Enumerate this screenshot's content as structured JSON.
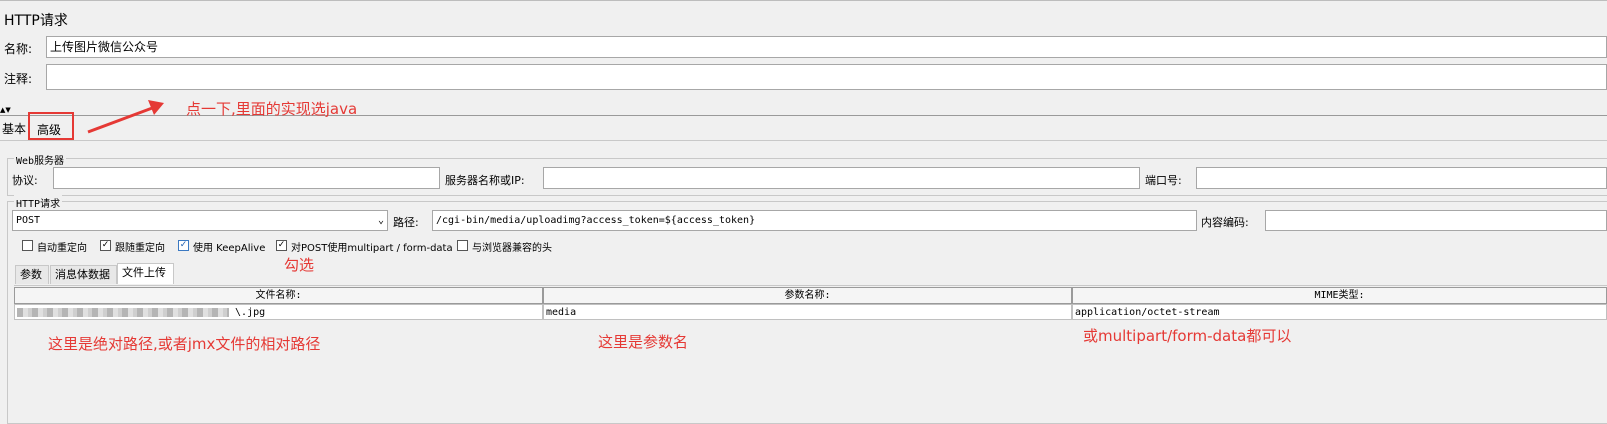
{
  "panel": {
    "title": "HTTP请求"
  },
  "form": {
    "name_label": "名称:",
    "name_value": "上传图片微信公众号",
    "comment_label": "注释:",
    "comment_value": ""
  },
  "tabs": {
    "basic": "基本",
    "advanced": "高级"
  },
  "web_server": {
    "title": "Web服务器",
    "protocol_label": "协议:",
    "protocol_value": "",
    "server_label": "服务器名称或IP:",
    "server_value": "",
    "port_label": "端口号:",
    "port_value": ""
  },
  "http_request": {
    "title": "HTTP请求",
    "method": "POST",
    "path_label": "路径:",
    "path_value": "/cgi-bin/media/uploadimg?access_token=${access_token}",
    "encoding_label": "内容编码:",
    "encoding_value": ""
  },
  "options": [
    {
      "label": "自动重定向",
      "checked": false
    },
    {
      "label": "跟随重定向",
      "checked": true
    },
    {
      "label": "使用 KeepAlive",
      "checked": true
    },
    {
      "label": "对POST使用multipart / form-data",
      "checked": true
    },
    {
      "label": "与浏览器兼容的头",
      "checked": false
    }
  ],
  "sub_tabs": [
    "参数",
    "消息体数据",
    "文件上传"
  ],
  "file_table": {
    "headers": [
      "文件名称:",
      "参数名称:",
      "MIME类型:"
    ],
    "rows": [
      {
        "file": "\\.jpg",
        "param": "media",
        "mime": "application/octet-stream"
      }
    ]
  },
  "annotations": {
    "click_note": "点一下,里面的实现选java",
    "check_note": "勾选",
    "path_note": "这里是绝对路径,或者jmx文件的相对路径",
    "param_note": "这里是参数名",
    "mime_note": "或multipart/form-data都可以"
  },
  "colors": {
    "annotation": "#e53935",
    "checkbox_blue": "#3b79c2"
  }
}
